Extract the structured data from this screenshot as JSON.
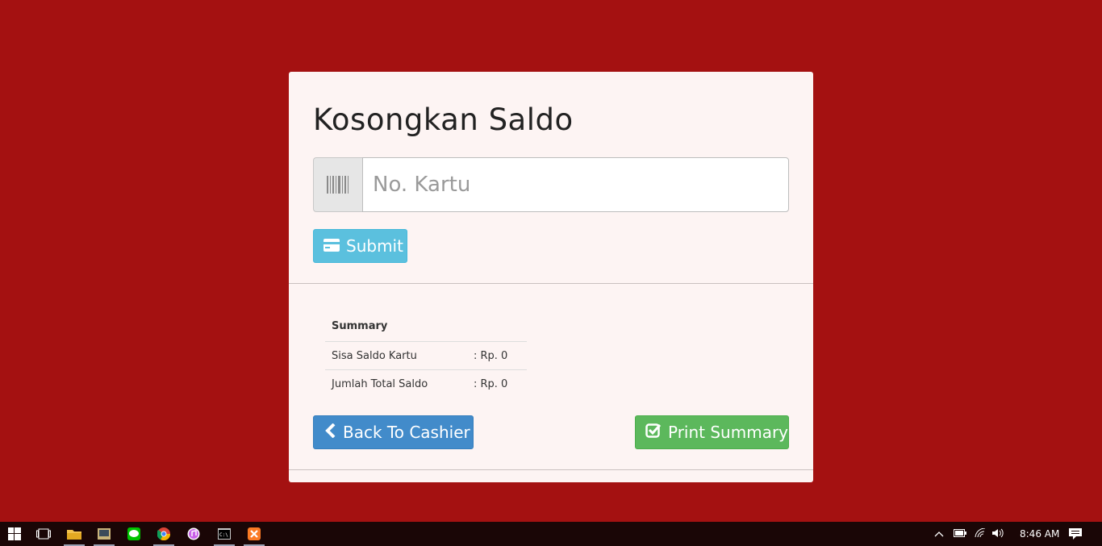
{
  "page": {
    "title": "Kosongkan Saldo",
    "card_input": {
      "placeholder": "No. Kartu",
      "value": ""
    },
    "submit_label": "Submit",
    "summary": {
      "heading": "Summary",
      "rows": [
        {
          "label": "Sisa Saldo Kartu",
          "value": ": Rp. 0"
        },
        {
          "label": "Jumlah Total Saldo",
          "value": ": Rp. 0"
        }
      ]
    },
    "back_label": "Back To Cashier",
    "print_label": "Print Summary"
  },
  "colors": {
    "background": "#a41111",
    "card": "#fdf4f3",
    "info": "#5bc0de",
    "primary": "#428bca",
    "success": "#5cb85c"
  },
  "taskbar": {
    "apps": [
      "windows-start-icon",
      "task-view-icon",
      "file-explorer-icon",
      "app-icon",
      "line-chat-icon",
      "chrome-icon",
      "itunes-icon",
      "command-prompt-icon",
      "xampp-icon"
    ],
    "clock": "8:46 AM"
  }
}
